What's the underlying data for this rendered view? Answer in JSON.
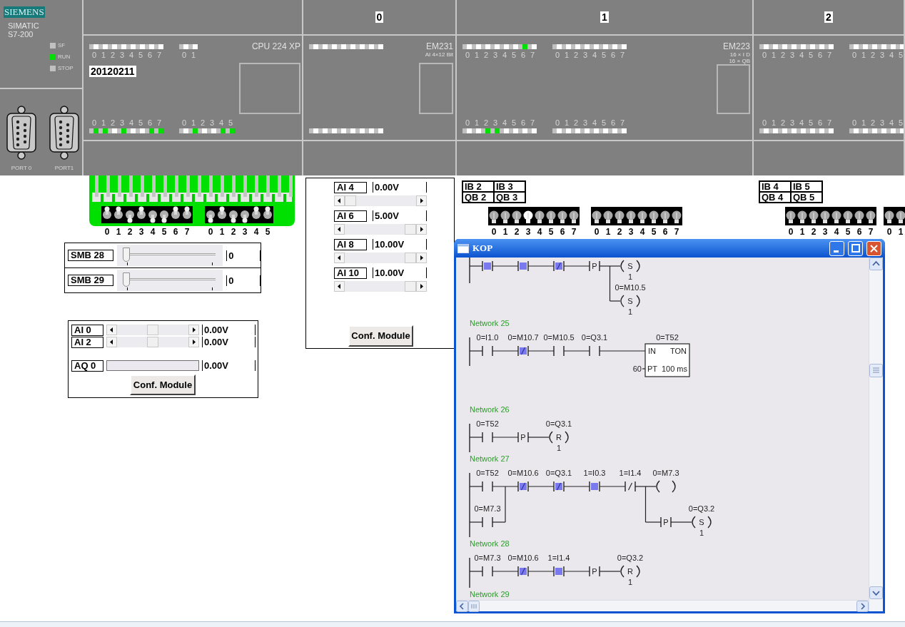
{
  "cpu": {
    "brand": "SIEMENS",
    "family": "SIMATIC",
    "series": "S7-200",
    "mode_leds": [
      {
        "label": "SF",
        "on": false
      },
      {
        "label": "RUN",
        "on": true
      },
      {
        "label": "STOP",
        "on": false
      }
    ],
    "ports": [
      {
        "label": "PORT 0"
      },
      {
        "label": "PORT1"
      }
    ],
    "model": "CPU 224 XP",
    "display": "20120211",
    "inputs": [
      {
        "leds": [
          {
            "label": "0",
            "on": false
          },
          {
            "label": "1",
            "on": false
          },
          {
            "label": "2",
            "on": false
          },
          {
            "label": "3",
            "on": false
          },
          {
            "label": "4",
            "on": false
          },
          {
            "label": "5",
            "on": false
          },
          {
            "label": "6",
            "on": false
          },
          {
            "label": "7",
            "on": false
          }
        ]
      },
      {
        "leds": [
          {
            "label": "0",
            "on": false
          },
          {
            "label": "1",
            "on": false
          }
        ]
      }
    ],
    "outputs": [
      {
        "leds": [
          {
            "label": "0",
            "on": true
          },
          {
            "label": "1",
            "on": true
          },
          {
            "label": "2",
            "on": false
          },
          {
            "label": "3",
            "on": true
          },
          {
            "label": "4",
            "on": false
          },
          {
            "label": "5",
            "on": false
          },
          {
            "label": "6",
            "on": true
          },
          {
            "label": "7",
            "on": true
          }
        ]
      },
      {
        "leds": [
          {
            "label": "0",
            "on": false
          },
          {
            "label": "1",
            "on": true
          },
          {
            "label": "2",
            "on": false
          },
          {
            "label": "3",
            "on": false
          },
          {
            "label": "4",
            "on": true
          },
          {
            "label": "5",
            "on": true
          }
        ]
      }
    ]
  },
  "modules": [
    {
      "slot": "0",
      "name": "EM231",
      "spec": [
        "AI 4×12 Bit"
      ],
      "inputs": [
        {
          "leds": [
            {
              "on": false
            },
            {
              "on": false
            },
            {
              "on": false
            },
            {
              "on": false
            },
            {
              "on": false
            },
            {
              "on": false
            },
            {
              "on": false
            },
            {
              "on": false
            }
          ]
        }
      ],
      "outputs": [
        {
          "leds": [
            {
              "on": false
            },
            {
              "on": false
            },
            {
              "on": false
            },
            {
              "on": false
            },
            {
              "on": false
            },
            {
              "on": false
            },
            {
              "on": false
            },
            {
              "on": false
            }
          ]
        }
      ]
    },
    {
      "slot": "1",
      "name": "EM223",
      "spec": [
        "16 × I D",
        "16 × QB"
      ],
      "inputs": [
        {
          "leds": [
            {
              "label": "0",
              "on": false
            },
            {
              "label": "1",
              "on": false
            },
            {
              "label": "2",
              "on": false
            },
            {
              "label": "3",
              "on": false
            },
            {
              "label": "4",
              "on": false
            },
            {
              "label": "5",
              "on": false
            },
            {
              "label": "6",
              "on": true
            },
            {
              "label": "7",
              "on": false
            }
          ]
        },
        {
          "leds": [
            {
              "label": "0",
              "on": false
            },
            {
              "label": "1",
              "on": false
            },
            {
              "label": "2",
              "on": false
            },
            {
              "label": "3",
              "on": false
            },
            {
              "label": "4",
              "on": false
            },
            {
              "label": "5",
              "on": false
            },
            {
              "label": "6",
              "on": false
            },
            {
              "label": "7",
              "on": false
            }
          ]
        }
      ],
      "outputs": [
        {
          "leds": [
            {
              "label": "0",
              "on": false
            },
            {
              "label": "1",
              "on": false
            },
            {
              "label": "2",
              "on": true
            },
            {
              "label": "3",
              "on": true
            },
            {
              "label": "4",
              "on": false
            },
            {
              "label": "5",
              "on": false
            },
            {
              "label": "6",
              "on": false
            },
            {
              "label": "7",
              "on": false
            }
          ]
        },
        {
          "leds": [
            {
              "label": "0",
              "on": false
            },
            {
              "label": "1",
              "on": false
            },
            {
              "label": "2",
              "on": false
            },
            {
              "label": "3",
              "on": false
            },
            {
              "label": "4",
              "on": false
            },
            {
              "label": "5",
              "on": false
            },
            {
              "label": "6",
              "on": false
            },
            {
              "label": "7",
              "on": false
            }
          ]
        }
      ]
    },
    {
      "slot": "2",
      "inputs": [
        {
          "leds": [
            {
              "label": "0",
              "on": false
            },
            {
              "label": "1",
              "on": false
            },
            {
              "label": "2",
              "on": false
            },
            {
              "label": "3",
              "on": false
            },
            {
              "label": "4",
              "on": false
            },
            {
              "label": "5",
              "on": false
            },
            {
              "label": "6",
              "on": false
            },
            {
              "label": "7",
              "on": false
            }
          ]
        },
        {
          "leds": [
            {
              "label": "0",
              "on": false
            },
            {
              "label": "1",
              "on": false
            },
            {
              "label": "2",
              "on": false
            },
            {
              "label": "3",
              "on": false
            },
            {
              "label": "4",
              "on": false
            },
            {
              "label": "5",
              "on": false
            }
          ]
        }
      ],
      "outputs": [
        {
          "leds": [
            {
              "label": "0",
              "on": false
            },
            {
              "label": "1",
              "on": false
            },
            {
              "label": "2",
              "on": false
            },
            {
              "label": "3",
              "on": false
            },
            {
              "label": "4",
              "on": false
            },
            {
              "label": "5",
              "on": false
            },
            {
              "label": "6",
              "on": false
            },
            {
              "label": "7",
              "on": false
            }
          ]
        },
        {
          "leds": [
            {
              "label": "0",
              "on": false
            },
            {
              "label": "1",
              "on": false
            },
            {
              "label": "2",
              "on": false
            },
            {
              "label": "3",
              "on": false
            },
            {
              "label": "4",
              "on": false
            },
            {
              "label": "5",
              "on": false
            }
          ]
        }
      ]
    }
  ],
  "input_switches": [
    {
      "switches": [
        {
          "label": "0",
          "on": true
        },
        {
          "label": "1",
          "on": true
        },
        {
          "label": "2",
          "on": false
        },
        {
          "label": "3",
          "on": true
        },
        {
          "label": "4",
          "on": false
        },
        {
          "label": "5",
          "on": false
        },
        {
          "label": "6",
          "on": true
        },
        {
          "label": "7",
          "on": true
        }
      ]
    },
    {
      "switches": [
        {
          "label": "0",
          "on": false
        },
        {
          "label": "1",
          "on": true
        },
        {
          "label": "2",
          "on": false
        },
        {
          "label": "3",
          "on": false
        },
        {
          "label": "4",
          "on": true
        },
        {
          "label": "5",
          "on": true
        }
      ]
    }
  ],
  "smb_sliders": [
    {
      "label": "SMB 28",
      "level": 0,
      "value": "0"
    },
    {
      "label": "SMB 29",
      "level": 0,
      "value": "0"
    }
  ],
  "analog_panel": {
    "inputs": [
      {
        "label": "AI 0",
        "level": 0.5,
        "value": "0.00V"
      },
      {
        "label": "AI 2",
        "level": 0.5,
        "value": "0.00V"
      }
    ],
    "output": {
      "label": "AQ 0",
      "level": 0,
      "value": "0.00V"
    },
    "button": "Conf. Module"
  },
  "em231_panel": {
    "inputs": [
      {
        "label": "AI 4",
        "level": 0,
        "value": "0.00V"
      },
      {
        "label": "AI 6",
        "level": 1,
        "value": "5.00V"
      },
      {
        "label": "AI 8",
        "level": 1,
        "value": "10.00V"
      },
      {
        "label": "AI 10",
        "level": 1,
        "value": "10.00V"
      }
    ],
    "button": "Conf. Module"
  },
  "io_panels": [
    {
      "cells": [
        "IB 2",
        "IB 3",
        "QB 2",
        "QB 3"
      ],
      "lamp_groups": [
        {
          "lamps": [
            {
              "label": "0",
              "lit": false
            },
            {
              "label": "1",
              "lit": false
            },
            {
              "label": "2",
              "lit": false
            },
            {
              "label": "3",
              "lit": true
            },
            {
              "label": "4",
              "lit": false
            },
            {
              "label": "5",
              "lit": false
            },
            {
              "label": "6",
              "lit": false
            },
            {
              "label": "7",
              "lit": false
            }
          ]
        },
        {
          "lamps": [
            {
              "label": "0",
              "lit": false
            },
            {
              "label": "1",
              "lit": false
            },
            {
              "label": "2",
              "lit": false
            },
            {
              "label": "3",
              "lit": false
            },
            {
              "label": "4",
              "lit": false
            },
            {
              "label": "5",
              "lit": false
            },
            {
              "label": "6",
              "lit": false
            },
            {
              "label": "7",
              "lit": false
            }
          ]
        }
      ]
    },
    {
      "cells": [
        "IB 4",
        "IB 5",
        "QB 4",
        "QB 5"
      ],
      "lamp_groups": [
        {
          "lamps": [
            {
              "label": "0",
              "lit": false
            },
            {
              "label": "1",
              "lit": false
            },
            {
              "label": "2",
              "lit": false
            },
            {
              "label": "3",
              "lit": false
            },
            {
              "label": "4",
              "lit": false
            },
            {
              "label": "5",
              "lit": false
            },
            {
              "label": "6",
              "lit": false
            },
            {
              "label": "7",
              "lit": false
            }
          ]
        },
        {
          "lamps": [
            {
              "label": "0",
              "lit": false
            },
            {
              "label": "1",
              "lit": false
            }
          ]
        }
      ]
    }
  ],
  "kop_window": {
    "title": "KOP",
    "networks": [
      {
        "elements": [
          {
            "kind": "contact",
            "negated": false,
            "active": true
          },
          {
            "kind": "contact",
            "negated": false,
            "active": true
          },
          {
            "kind": "contact",
            "negated": true,
            "active": true
          },
          {
            "kind": "transition",
            "text": "P"
          },
          {
            "kind": "coil",
            "text": "S",
            "count": "1"
          }
        ],
        "branches": [
          {
            "elements": [
              {
                "kind": "coil",
                "label": "0=M10.5",
                "text": "S",
                "count": "1"
              }
            ]
          }
        ]
      },
      {
        "title": "Network 25",
        "elements": [
          {
            "kind": "contact",
            "label": "0=I1.0",
            "negated": false,
            "active": false
          },
          {
            "kind": "contact",
            "label": "0=M10.7",
            "negated": true,
            "active": true
          },
          {
            "kind": "contact",
            "label": "0=M10.5",
            "negated": false,
            "active": false
          },
          {
            "kind": "contact",
            "label": "0=Q3.1",
            "negated": false,
            "active": false
          },
          {
            "kind": "box",
            "label": "0=T52",
            "input": "IN",
            "type": "TON",
            "param": "PT",
            "param_value": "60",
            "time_base": "100 ms"
          }
        ]
      },
      {
        "title": "Network 26",
        "elements": [
          {
            "kind": "contact",
            "label": "0=T52",
            "negated": false,
            "active": false
          },
          {
            "kind": "transition",
            "text": "P"
          },
          {
            "kind": "coil",
            "label": "0=Q3.1",
            "text": "R",
            "count": "1"
          }
        ]
      },
      {
        "title": "Network 27",
        "elements": [
          {
            "kind": "contact",
            "label": "0=T52",
            "negated": false,
            "active": false
          },
          {
            "kind": "contact",
            "label": "0=M10.6",
            "negated": true,
            "active": true
          },
          {
            "kind": "contact",
            "label": "0=Q3.1",
            "negated": true,
            "active": true
          },
          {
            "kind": "contact",
            "label": "1=I0.3",
            "negated": false,
            "active": true
          },
          {
            "kind": "contact",
            "label": "1=I1.4",
            "negated": true,
            "active": false
          },
          {
            "kind": "coil",
            "label": "0=M7.3"
          }
        ],
        "branches": [
          {
            "elements": [
              {
                "kind": "contact",
                "label": "0=M7.3",
                "negated": false,
                "active": false
              }
            ]
          },
          {
            "elements": [
              {
                "kind": "transition",
                "text": "P"
              },
              {
                "kind": "coil",
                "label": "0=Q3.2",
                "text": "S",
                "count": "1"
              }
            ]
          }
        ]
      },
      {
        "title": "Network 28",
        "elements": [
          {
            "kind": "contact",
            "label": "0=M7.3",
            "negated": false,
            "active": false
          },
          {
            "kind": "contact",
            "label": "0=M10.6",
            "negated": true,
            "active": true
          },
          {
            "kind": "contact",
            "label": "1=I1.4",
            "negated": false,
            "active": true
          },
          {
            "kind": "transition",
            "text": "P"
          },
          {
            "kind": "coil",
            "label": "0=Q3.2",
            "text": "R",
            "count": "1"
          }
        ]
      },
      {
        "title": "Network 29"
      }
    ]
  }
}
